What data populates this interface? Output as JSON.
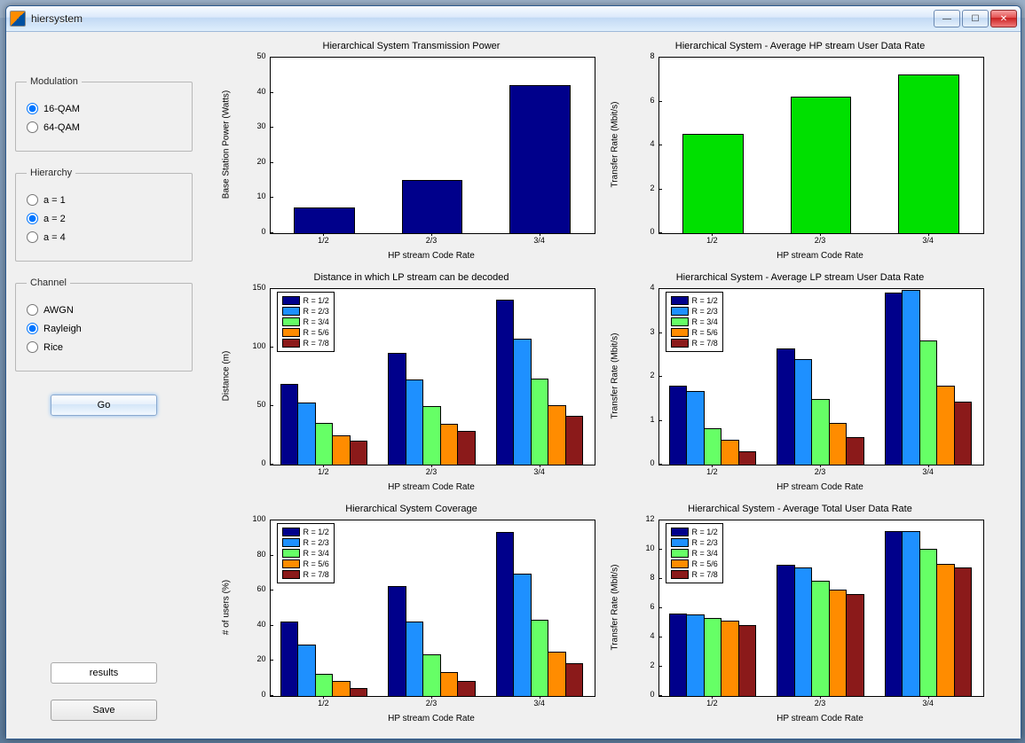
{
  "window": {
    "title": "hiersystem"
  },
  "sidebar": {
    "modulation": {
      "legend": "Modulation",
      "options": [
        "16-QAM",
        "64-QAM"
      ],
      "selected": "16-QAM"
    },
    "hierarchy": {
      "legend": "Hierarchy",
      "options": [
        "a = 1",
        "a = 2",
        "a = 4"
      ],
      "selected": "a = 2"
    },
    "channel": {
      "legend": "Channel",
      "options": [
        "AWGN",
        "Rayleigh",
        "Rice"
      ],
      "selected": "Rayleigh"
    },
    "go": "Go",
    "results": "results",
    "save": "Save"
  },
  "colors": {
    "series": [
      "#00008b",
      "#1e90ff",
      "#66ff66",
      "#ff8c00",
      "#8b1a1a"
    ],
    "single_navy": "#00008b",
    "single_green": "#00e000"
  },
  "legend_labels": [
    "R = 1/2",
    "R = 2/3",
    "R = 3/4",
    "R = 5/6",
    "R = 7/8"
  ],
  "chart_data": [
    {
      "id": "tx_power",
      "type": "bar",
      "title": "Hierarchical System Transmission Power",
      "xlabel": "HP stream Code Rate",
      "ylabel": "Base Station Power (Watts)",
      "categories": [
        "1/2",
        "2/3",
        "3/4"
      ],
      "values": [
        7,
        15,
        42
      ],
      "ylim": [
        0,
        50
      ],
      "yticks": [
        0,
        10,
        20,
        30,
        40,
        50
      ],
      "color_key": "single_navy"
    },
    {
      "id": "hp_rate",
      "type": "bar",
      "title": "Hierarchical System - Average HP stream User Data Rate",
      "xlabel": "HP stream Code Rate",
      "ylabel": "Transfer Rate (Mbit/s)",
      "categories": [
        "1/2",
        "2/3",
        "3/4"
      ],
      "values": [
        4.5,
        6.2,
        7.2
      ],
      "ylim": [
        0,
        8
      ],
      "yticks": [
        0,
        2,
        4,
        6,
        8
      ],
      "color_key": "single_green"
    },
    {
      "id": "lp_distance",
      "type": "grouped_bar",
      "title": "Distance in which LP stream can be decoded",
      "xlabel": "HP stream Code Rate",
      "ylabel": "Distance (m)",
      "categories": [
        "1/2",
        "2/3",
        "3/4"
      ],
      "series": [
        {
          "name": "R = 1/2",
          "values": [
            68,
            95,
            140
          ]
        },
        {
          "name": "R = 2/3",
          "values": [
            52,
            72,
            107
          ]
        },
        {
          "name": "R = 3/4",
          "values": [
            35,
            49,
            73
          ]
        },
        {
          "name": "R = 5/6",
          "values": [
            24,
            34,
            50
          ]
        },
        {
          "name": "R = 7/8",
          "values": [
            20,
            28,
            41
          ]
        }
      ],
      "ylim": [
        0,
        150
      ],
      "yticks": [
        0,
        50,
        100,
        150
      ],
      "legend_pos": "inside-top-left"
    },
    {
      "id": "lp_rate",
      "type": "grouped_bar",
      "title": "Hierarchical System - Average LP stream User Data Rate",
      "xlabel": "HP stream Code Rate",
      "ylabel": "Transfer Rate (Mbit/s)",
      "categories": [
        "1/2",
        "2/3",
        "3/4"
      ],
      "series": [
        {
          "name": "R = 1/2",
          "values": [
            1.78,
            2.62,
            3.9
          ]
        },
        {
          "name": "R = 2/3",
          "values": [
            1.65,
            2.38,
            3.95
          ]
        },
        {
          "name": "R = 3/4",
          "values": [
            0.8,
            1.48,
            2.8
          ]
        },
        {
          "name": "R = 5/6",
          "values": [
            0.55,
            0.93,
            1.78
          ]
        },
        {
          "name": "R = 7/8",
          "values": [
            0.28,
            0.6,
            1.42
          ]
        }
      ],
      "ylim": [
        0,
        4
      ],
      "yticks": [
        0,
        1,
        2,
        3,
        4
      ],
      "legend_pos": "inside-top-left"
    },
    {
      "id": "coverage",
      "type": "grouped_bar",
      "title": "Hierarchical System Coverage",
      "xlabel": "HP stream Code Rate",
      "ylabel": "# of users (%)",
      "categories": [
        "1/2",
        "2/3",
        "3/4"
      ],
      "series": [
        {
          "name": "R = 1/2",
          "values": [
            42,
            62,
            93
          ]
        },
        {
          "name": "R = 2/3",
          "values": [
            29,
            42,
            69
          ]
        },
        {
          "name": "R = 3/4",
          "values": [
            12,
            23,
            43
          ]
        },
        {
          "name": "R = 5/6",
          "values": [
            8,
            13,
            25
          ]
        },
        {
          "name": "R = 7/8",
          "values": [
            4,
            8,
            18
          ]
        }
      ],
      "ylim": [
        0,
        100
      ],
      "yticks": [
        0,
        20,
        40,
        60,
        80,
        100
      ],
      "legend_pos": "inside-top-left"
    },
    {
      "id": "total_rate",
      "type": "grouped_bar",
      "title": "Hierarchical System - Average Total User Data Rate",
      "xlabel": "HP stream Code Rate",
      "ylabel": "Transfer Rate (Mbit/s)",
      "categories": [
        "1/2",
        "2/3",
        "3/4"
      ],
      "series": [
        {
          "name": "R = 1/2",
          "values": [
            5.6,
            8.9,
            11.2
          ]
        },
        {
          "name": "R = 2/3",
          "values": [
            5.5,
            8.7,
            11.2
          ]
        },
        {
          "name": "R = 3/4",
          "values": [
            5.3,
            7.8,
            10.0
          ]
        },
        {
          "name": "R = 5/6",
          "values": [
            5.1,
            7.2,
            9.0
          ]
        },
        {
          "name": "R = 7/8",
          "values": [
            4.8,
            6.9,
            8.7
          ]
        }
      ],
      "ylim": [
        0,
        12
      ],
      "yticks": [
        0,
        2,
        4,
        6,
        8,
        10,
        12
      ],
      "legend_pos": "inside-top-left"
    }
  ]
}
